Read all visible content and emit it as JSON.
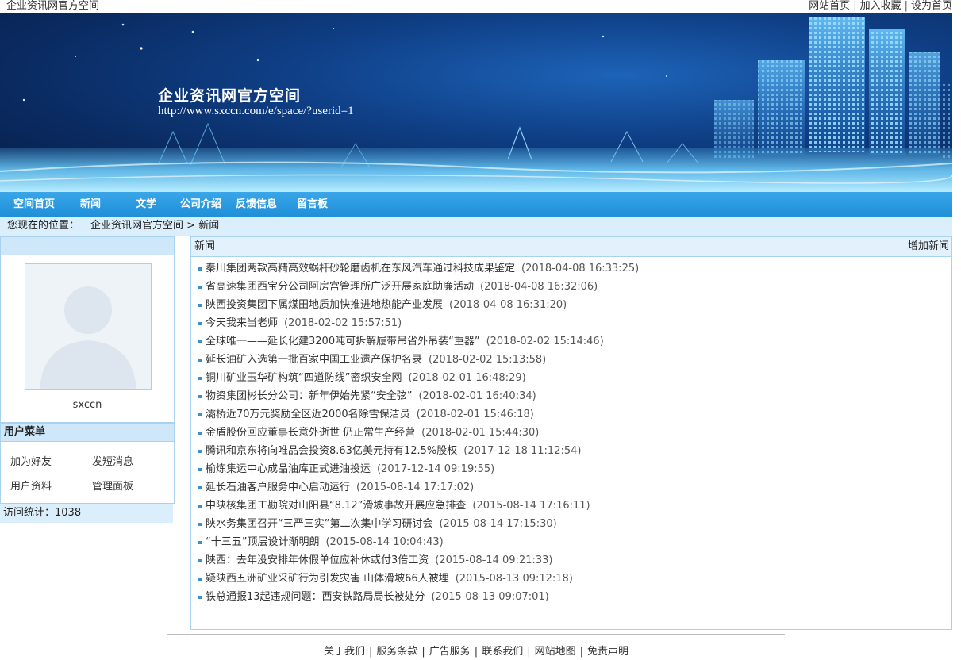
{
  "topbar": {
    "site_name": "企业资讯网官方空间",
    "links": [
      "网站首页",
      "加入收藏",
      "设为首页"
    ],
    "separator": "|"
  },
  "banner": {
    "title": "企业资讯网官方空间",
    "url": "http://www.sxccn.com/e/space/?userid=1"
  },
  "nav": {
    "items": [
      "空间首页",
      "新闻",
      "文学",
      "公司介绍",
      "反馈信息",
      "留言板"
    ]
  },
  "breadcrumb": {
    "lead": "您现在的位置：",
    "home": "企业资讯网官方空间",
    "sep": ">",
    "current": "新闻"
  },
  "profile": {
    "username": "sxccn"
  },
  "user_menu": {
    "title": "用户菜单",
    "items": [
      "加为好友",
      "发短消息",
      "用户资料",
      "管理面板"
    ]
  },
  "visits": {
    "label": "访问统计：",
    "count": "1038"
  },
  "main": {
    "title": "新闻",
    "add_label": "增加新闻",
    "news": [
      {
        "title": "秦川集团两款高精高效蜗杆砂轮磨齿机在东风汽车通过科技成果鉴定",
        "date": "(2018-04-08 16:33:25)"
      },
      {
        "title": "省高速集团西宝分公司阿房宫管理所广泛开展家庭助廉活动",
        "date": "(2018-04-08 16:32:06)"
      },
      {
        "title": "陕西投资集团下属煤田地质加快推进地热能产业发展",
        "date": "(2018-04-08 16:31:20)"
      },
      {
        "title": "今天我来当老师",
        "date": "(2018-02-02 15:57:51)"
      },
      {
        "title": "全球唯一——延长化建3200吨可拆解履带吊省外吊装“重器”",
        "date": "(2018-02-02 15:14:46)"
      },
      {
        "title": "延长油矿入选第一批百家中国工业遗产保护名录",
        "date": "(2018-02-02 15:13:58)"
      },
      {
        "title": "铜川矿业玉华矿构筑“四道防线”密织安全网",
        "date": "(2018-02-01 16:48:29)"
      },
      {
        "title": "物资集团彬长分公司：新年伊始先紧“安全弦”",
        "date": "(2018-02-01 16:40:34)"
      },
      {
        "title": "灞桥近70万元奖励全区近2000名除雪保洁员",
        "date": "(2018-02-01 15:46:18)"
      },
      {
        "title": "金盾股份回应董事长意外逝世 仍正常生产经营",
        "date": "(2018-02-01 15:44:30)"
      },
      {
        "title": "腾讯和京东将向唯品会投资8.63亿美元持有12.5%股权",
        "date": "(2017-12-18 11:12:54)"
      },
      {
        "title": "榆炼集运中心成品油库正式进油投运",
        "date": "(2017-12-14 09:19:55)"
      },
      {
        "title": "延长石油客户服务中心启动运行",
        "date": "(2015-08-14 17:17:02)"
      },
      {
        "title": "中陕核集团工勘院对山阳县“8.12”滑坡事故开展应急排查",
        "date": "(2015-08-14 17:16:11)"
      },
      {
        "title": "陕水务集团召开“三严三实”第二次集中学习研讨会",
        "date": "(2015-08-14 17:15:30)"
      },
      {
        "title": "“十三五”顶层设计渐明朗",
        "date": "(2015-08-14 10:04:43)"
      },
      {
        "title": "陕西：去年没安排年休假单位应补休或付3倍工资",
        "date": "(2015-08-14 09:21:33)"
      },
      {
        "title": "疑陕西五洲矿业采矿行为引发灾害 山体滑坡66人被埋",
        "date": "(2015-08-13 09:12:18)"
      },
      {
        "title": "铁总通报13起违规问题：西安铁路局局长被处分",
        "date": "(2015-08-13 09:07:01)"
      }
    ]
  },
  "footer": {
    "links": [
      "关于我们",
      "服务条款",
      "广告服务",
      "联系我们",
      "网站地图",
      "免责声明"
    ],
    "separator": "|"
  }
}
